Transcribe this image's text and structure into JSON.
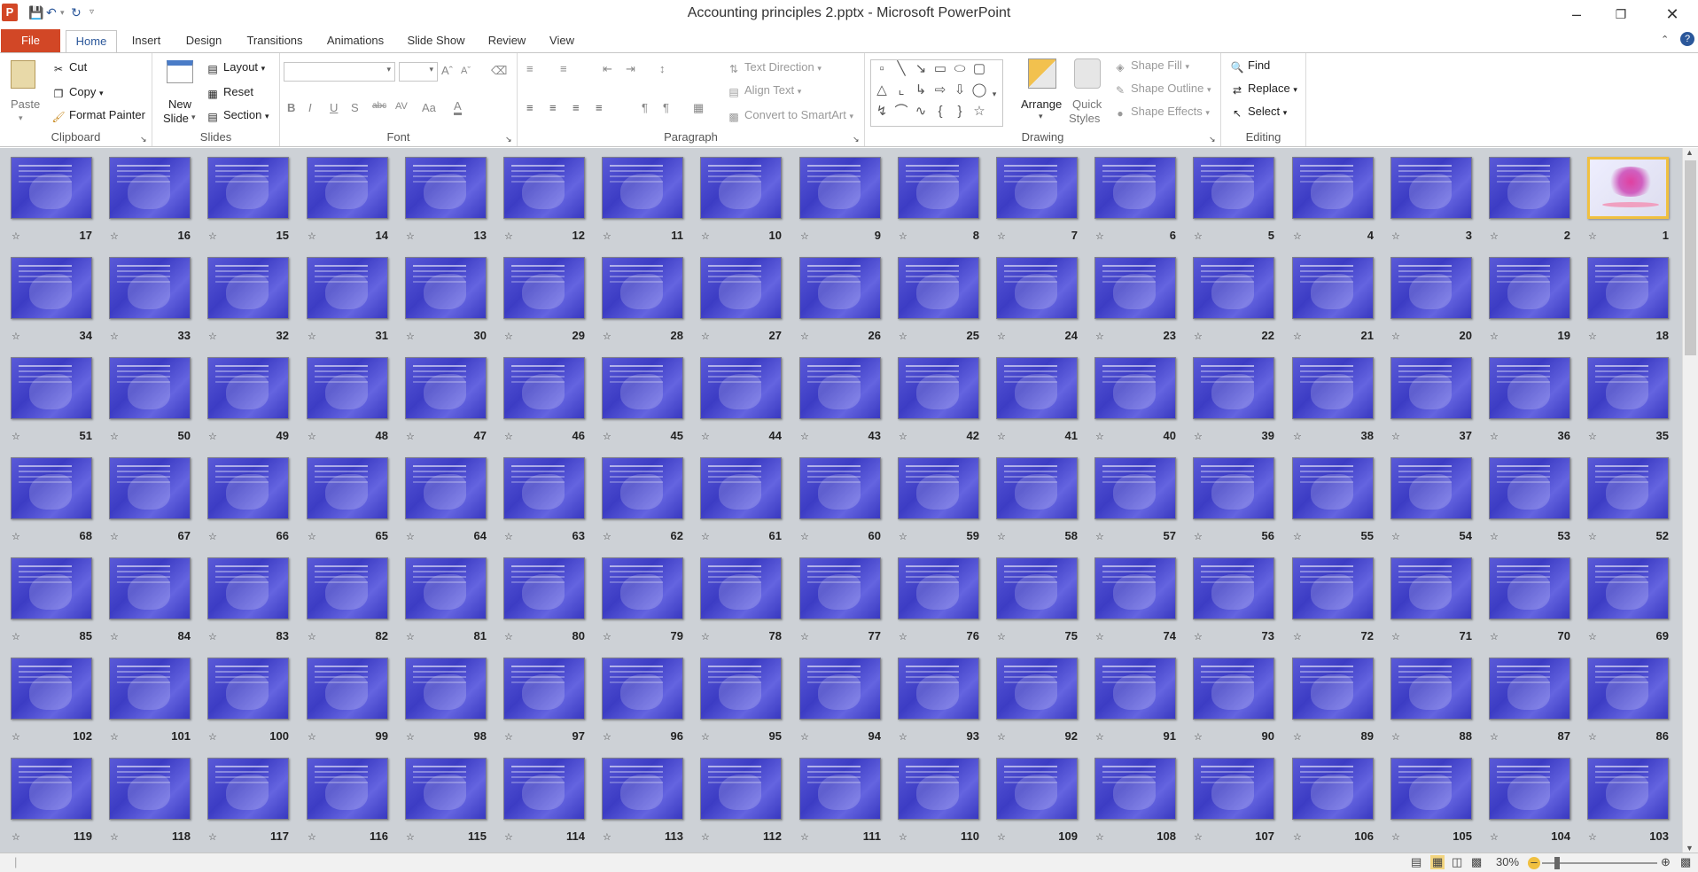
{
  "window": {
    "title": "Accounting principles 2.pptx - Microsoft PowerPoint"
  },
  "tabs": [
    "File",
    "Home",
    "Insert",
    "Design",
    "Transitions",
    "Animations",
    "Slide Show",
    "Review",
    "View"
  ],
  "ribbon": {
    "clipboard": {
      "label": "Clipboard",
      "paste": "Paste",
      "cut": "Cut",
      "copy": "Copy",
      "format_painter": "Format Painter"
    },
    "slides": {
      "label": "Slides",
      "new_slide_1": "New",
      "new_slide_2": "Slide",
      "layout": "Layout",
      "reset": "Reset",
      "section": "Section"
    },
    "font": {
      "label": "Font",
      "font_name": "",
      "font_size": ""
    },
    "paragraph": {
      "label": "Paragraph",
      "text_direction": "Text Direction",
      "align_text": "Align Text",
      "convert_smartart": "Convert to SmartArt"
    },
    "drawing": {
      "label": "Drawing",
      "arrange": "Arrange",
      "quick_styles_1": "Quick",
      "quick_styles_2": "Styles",
      "shape_fill": "Shape Fill",
      "shape_outline": "Shape Outline",
      "shape_effects": "Shape Effects"
    },
    "editing": {
      "label": "Editing",
      "find": "Find",
      "replace": "Replace",
      "select": "Select"
    }
  },
  "slides": {
    "total_visible": 119,
    "selected": 1
  },
  "statusbar": {
    "zoom": "30%"
  },
  "colors": {
    "file_tab": "#d24726",
    "accent": "#2b579a",
    "thumb": "#4848cc",
    "selection": "#f0c040"
  }
}
